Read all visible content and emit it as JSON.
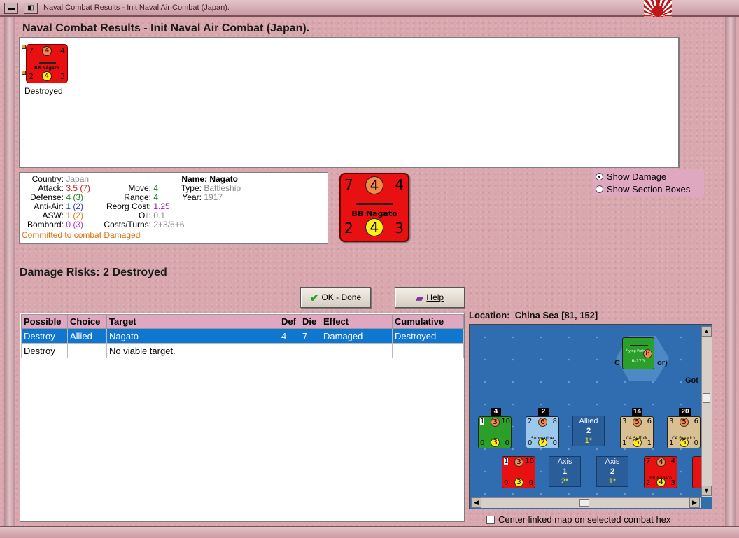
{
  "window": {
    "title": "Naval Combat Results - Init Naval Air Combat (Japan).",
    "minimize_icon": "minimize-icon"
  },
  "header": {
    "title": "Naval Combat Results - Init Naval Air Combat (Japan)."
  },
  "results": {
    "counter": {
      "attack": "7",
      "attack_circle": "4",
      "range": "4",
      "name": "BB Nagato",
      "defense": "2",
      "def_circle": "4",
      "move": "3"
    },
    "status": "Destroyed"
  },
  "info": {
    "country_label": "Country:",
    "country": "Japan",
    "attack_label": "Attack:",
    "attack": "3.5",
    "attack_paren": "(7)",
    "defense_label": "Defense:",
    "defense": "4",
    "defense_paren": "(3)",
    "antiair_label": "Anti-Air:",
    "antiair": "1",
    "antiair_paren": "(2)",
    "asw_label": "ASW:",
    "asw": "1",
    "asw_paren": "(2)",
    "bombard_label": "Bombard:",
    "bombard": "0",
    "bombard_paren": "(3)",
    "move_label": "Move:",
    "move": "4",
    "range_label": "Range:",
    "range": "4",
    "reorg_label": "Reorg Cost:",
    "reorg": "1.25",
    "oil_label": "Oil:",
    "oil": "0.1",
    "costs_label": "Costs/Turns:",
    "costs": "2+3/6+6",
    "name_label": "Name:",
    "name": "Nagato",
    "type_label": "Type:",
    "type": "Battleship",
    "year_label": "Year:",
    "year": "1917",
    "committed": "Committed to combat Damaged"
  },
  "big_counter": {
    "attack": "7",
    "attack_circle": "4",
    "range": "4",
    "name": "BB Nagato",
    "defense": "2",
    "def_circle": "4",
    "move": "3"
  },
  "display_options": {
    "show_damage": "Show Damage",
    "show_section_boxes": "Show Section Boxes",
    "selected": "show_damage"
  },
  "damage_risks": "Damage Risks:  2 Destroyed",
  "buttons": {
    "ok": "OK - Done",
    "help": "Help"
  },
  "table": {
    "headers": [
      "Possible",
      "Choice",
      "Target",
      "Def",
      "Die",
      "Effect",
      "Cumulative"
    ],
    "rows": [
      [
        "Destroy",
        "Allied",
        "Nagato",
        "4",
        "7",
        "Damaged",
        "Destroyed"
      ],
      [
        "Destroy",
        "",
        "No viable target.",
        "",
        "",
        "",
        ""
      ]
    ],
    "selected_row": 0
  },
  "location": {
    "label": "Location:",
    "value": "China Sea [81, 152]"
  },
  "map": {
    "hex_unit": {
      "name": "B-17G",
      "value": "8",
      "top_text": "Flying Fortress"
    },
    "hex_label_partial": "C",
    "hex_label_suffix": "or)",
    "edge_label": "Got",
    "allied_row": [
      {
        "stack": "4",
        "tl": "1",
        "tc": "3",
        "tr": "10",
        "bl": "0",
        "bc": "3",
        "br": "0",
        "name": "",
        "color": "#2aa02a"
      },
      {
        "stack": "2",
        "tl": "2",
        "tc": "6",
        "tr": "8",
        "bl": "0",
        "bc": "2",
        "br": "0",
        "name": "Submarine",
        "color": "#9cc8ec"
      },
      {
        "stack": "14",
        "tl": "3",
        "tc": "5",
        "tr": "6",
        "bl": "1",
        "bc": "5",
        "br": "1",
        "name": "CA Suffolk",
        "color": "#d8c090"
      },
      {
        "stack": "20",
        "tl": "3",
        "tc": "5",
        "tr": "6",
        "bl": "1",
        "bc": "5",
        "br": "0",
        "name": "CA Berwick",
        "color": "#d8c090"
      }
    ],
    "allied_summary": {
      "side": "Allied",
      "count": "2",
      "value": "1*"
    },
    "axis_row": [
      {
        "tl": "1",
        "tc": "3",
        "tr": "10",
        "bl": "0",
        "bc": "3",
        "br": "0",
        "name": "",
        "color": "#e81010"
      },
      {
        "tl": "7",
        "tc": "4",
        "tr": "4",
        "bl": "2",
        "bc": "4",
        "br": "3",
        "name": "BB Nagato",
        "color": "#e81010"
      }
    ],
    "axis_summary_1": {
      "side": "Axis",
      "count": "1",
      "value": "2*"
    },
    "axis_summary_2": {
      "side": "Axis",
      "count": "2",
      "value": "1*"
    }
  },
  "center_map": {
    "label": "Center linked map on selected combat hex",
    "checked": false
  },
  "colors": {
    "background": "#d9a7ae",
    "selection": "#1077d0",
    "header_pink": "#e0a8c0",
    "japan_red": "#e81010"
  }
}
